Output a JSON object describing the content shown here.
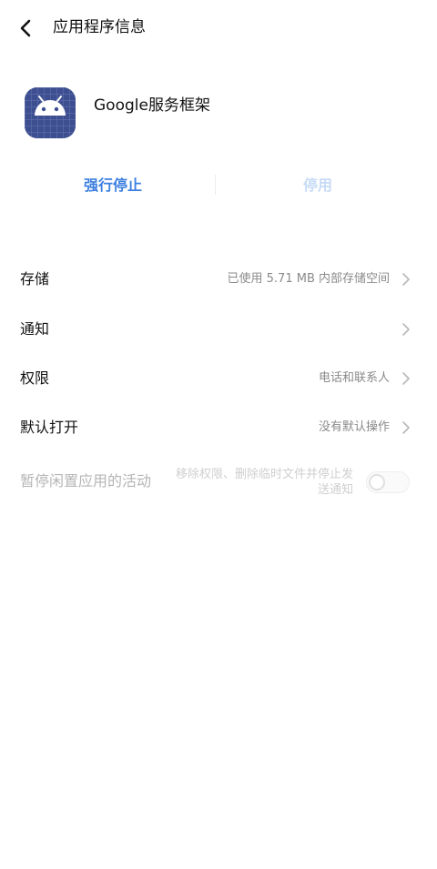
{
  "header": {
    "title": "应用程序信息",
    "back_icon": "chevron-left-icon"
  },
  "app": {
    "name": "Google服务框架",
    "icon": "android-icon",
    "icon_color": "#3d4f90"
  },
  "actions": {
    "force_stop_label": "强行停止",
    "disable_label": "停用",
    "accent_color": "#3c7fe0"
  },
  "settings": {
    "storage": {
      "label": "存储",
      "value": "已使用 5.71 MB 内部存储空间"
    },
    "notifications": {
      "label": "通知"
    },
    "permissions": {
      "label": "权限",
      "value": "电话和联系人"
    },
    "default_open": {
      "label": "默认打开",
      "value": "没有默认操作"
    },
    "pause_idle": {
      "label": "暂停闲置应用的活动",
      "note": "移除权限、删除临时文件并停止发送通知",
      "enabled": false
    }
  }
}
